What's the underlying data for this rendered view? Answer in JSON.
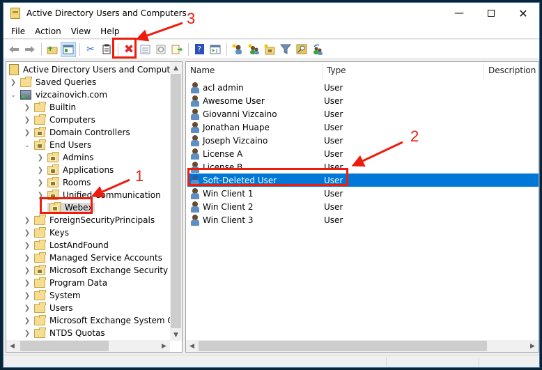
{
  "window": {
    "title": "Active Directory Users and Computers",
    "controls": [
      "minimize",
      "maximize",
      "close"
    ]
  },
  "menu": [
    "File",
    "Action",
    "View",
    "Help"
  ],
  "toolbar": [
    {
      "name": "back",
      "icon": "back-arrow-icon"
    },
    {
      "name": "forward",
      "icon": "forward-arrow-icon"
    },
    {
      "name": "up-one-level",
      "icon": "folder-up-icon"
    },
    {
      "name": "show-hide-console-tree",
      "icon": "console-tree-icon",
      "active": true
    },
    {
      "name": "cut",
      "icon": "scissors-icon"
    },
    {
      "name": "paste",
      "icon": "clipboard-icon"
    },
    {
      "name": "delete",
      "icon": "delete-x-icon"
    },
    {
      "name": "properties",
      "icon": "properties-icon"
    },
    {
      "name": "refresh",
      "icon": "refresh-icon"
    },
    {
      "name": "export-list",
      "icon": "export-list-icon"
    },
    {
      "name": "help",
      "icon": "help-icon"
    },
    {
      "name": "show-hide-action-pane",
      "icon": "action-pane-icon"
    },
    {
      "name": "create-user",
      "icon": "new-user-icon"
    },
    {
      "name": "create-group",
      "icon": "new-group-icon"
    },
    {
      "name": "create-ou",
      "icon": "new-ou-icon"
    },
    {
      "name": "filter",
      "icon": "filter-icon"
    },
    {
      "name": "find",
      "icon": "find-icon"
    },
    {
      "name": "add-to-group",
      "icon": "add-to-group-icon"
    }
  ],
  "tree": {
    "root": "Active Directory Users and Computers [S",
    "items": [
      {
        "label": "Saved Queries",
        "level": 1,
        "expander": "collapsed",
        "icon": "folder"
      },
      {
        "label": "vizcainovich.com",
        "level": 1,
        "expander": "expanded",
        "icon": "domain"
      },
      {
        "label": "Builtin",
        "level": 2,
        "expander": "collapsed",
        "icon": "folder"
      },
      {
        "label": "Computers",
        "level": 2,
        "expander": "collapsed",
        "icon": "folder"
      },
      {
        "label": "Domain Controllers",
        "level": 2,
        "expander": "collapsed",
        "icon": "ou"
      },
      {
        "label": "End Users",
        "level": 2,
        "expander": "expanded",
        "icon": "ou"
      },
      {
        "label": "Admins",
        "level": 3,
        "expander": "collapsed",
        "icon": "ou"
      },
      {
        "label": "Applications",
        "level": 3,
        "expander": "collapsed",
        "icon": "ou"
      },
      {
        "label": "Rooms",
        "level": 3,
        "expander": "collapsed",
        "icon": "ou"
      },
      {
        "label": "Unified Communication",
        "level": 3,
        "expander": "collapsed",
        "icon": "ou"
      },
      {
        "label": "Webex",
        "level": 3,
        "expander": "none",
        "icon": "ou",
        "selected": true
      },
      {
        "label": "ForeignSecurityPrincipals",
        "level": 2,
        "expander": "collapsed",
        "icon": "folder"
      },
      {
        "label": "Keys",
        "level": 2,
        "expander": "collapsed",
        "icon": "folder"
      },
      {
        "label": "LostAndFound",
        "level": 2,
        "expander": "collapsed",
        "icon": "folder"
      },
      {
        "label": "Managed Service Accounts",
        "level": 2,
        "expander": "collapsed",
        "icon": "folder"
      },
      {
        "label": "Microsoft Exchange Security Grou",
        "level": 2,
        "expander": "collapsed",
        "icon": "ou"
      },
      {
        "label": "Program Data",
        "level": 2,
        "expander": "collapsed",
        "icon": "folder"
      },
      {
        "label": "System",
        "level": 2,
        "expander": "collapsed",
        "icon": "folder"
      },
      {
        "label": "Users",
        "level": 2,
        "expander": "collapsed",
        "icon": "folder"
      },
      {
        "label": "Microsoft Exchange System Obje",
        "level": 2,
        "expander": "collapsed",
        "icon": "folder"
      },
      {
        "label": "NTDS Quotas",
        "level": 2,
        "expander": "collapsed",
        "icon": "folder"
      }
    ]
  },
  "list": {
    "columns": [
      "Name",
      "Type",
      "Description"
    ],
    "rows": [
      {
        "name": "acl admin",
        "type": "User",
        "description": ""
      },
      {
        "name": "Awesome User",
        "type": "User",
        "description": ""
      },
      {
        "name": "Giovanni Vizcaino",
        "type": "User",
        "description": ""
      },
      {
        "name": "Jonathan Huape",
        "type": "User",
        "description": ""
      },
      {
        "name": "Joseph Vizcaino",
        "type": "User",
        "description": ""
      },
      {
        "name": "License A",
        "type": "User",
        "description": ""
      },
      {
        "name": "License B",
        "type": "User",
        "description": ""
      },
      {
        "name": "Soft-Deleted User",
        "type": "User",
        "description": "",
        "selected": true
      },
      {
        "name": "Win Client 1",
        "type": "User",
        "description": ""
      },
      {
        "name": "Win Client 2",
        "type": "User",
        "description": ""
      },
      {
        "name": "Win Client 3",
        "type": "User",
        "description": ""
      }
    ]
  },
  "annotations": [
    {
      "number": "1",
      "target": "Webex tree item"
    },
    {
      "number": "2",
      "target": "Soft-Deleted User row"
    },
    {
      "number": "3",
      "target": "Delete toolbar button"
    }
  ],
  "colors": {
    "selection": "#0078d7",
    "annotation": "#ee1c0c"
  }
}
